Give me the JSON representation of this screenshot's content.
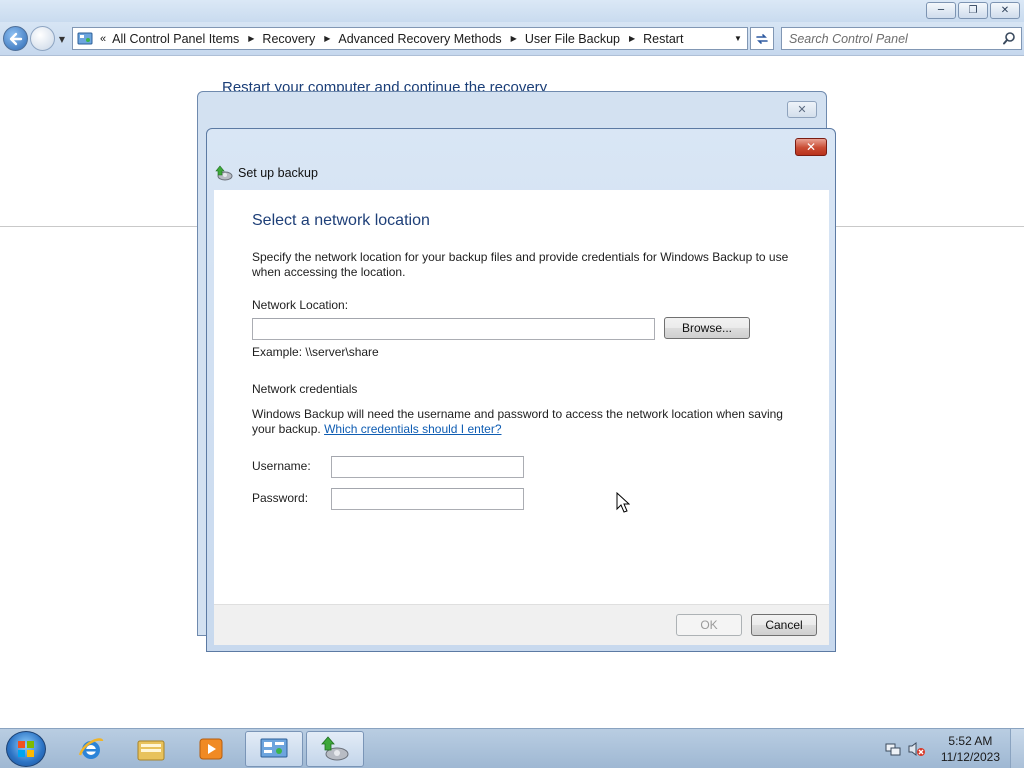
{
  "window": {
    "caption_buttons": {
      "minimize": "─",
      "restore": "❐",
      "close": "✕"
    }
  },
  "navigation": {
    "overflow": "«",
    "breadcrumbs": [
      "All Control Panel Items",
      "Recovery",
      "Advanced Recovery Methods",
      "User File Backup",
      "Restart"
    ],
    "search_placeholder": "Search Control Panel"
  },
  "background": {
    "heading": "Restart your computer and continue the recovery"
  },
  "dialog": {
    "title": "Set up backup",
    "heading": "Select a network location",
    "description": "Specify the network location for your backup files and provide credentials for Windows Backup to use when accessing the location.",
    "network_location_label": "Network Location:",
    "network_location_value": "",
    "browse_button": "Browse...",
    "example_text": "Example: \\\\server\\share",
    "credentials_heading": "Network credentials",
    "credentials_desc": "Windows Backup will need the username and password to access the network location when saving your backup.",
    "credentials_link": "Which credentials should I enter?",
    "username_label": "Username:",
    "username_value": "",
    "password_label": "Password:",
    "password_value": "",
    "ok_button": "OK",
    "cancel_button": "Cancel"
  },
  "taskbar": {
    "items": [
      "start-orb",
      "internet-explorer-icon",
      "windows-explorer-icon",
      "media-player-icon",
      "control-panel-icon",
      "backup-icon"
    ],
    "active_items": [
      "control-panel-icon",
      "backup-icon"
    ],
    "clock_time": "5:52 AM",
    "clock_date": "11/12/2023"
  },
  "colors": {
    "accent_heading": "#1e3f78",
    "link": "#0f5db3",
    "close_button": "#c94b33"
  }
}
